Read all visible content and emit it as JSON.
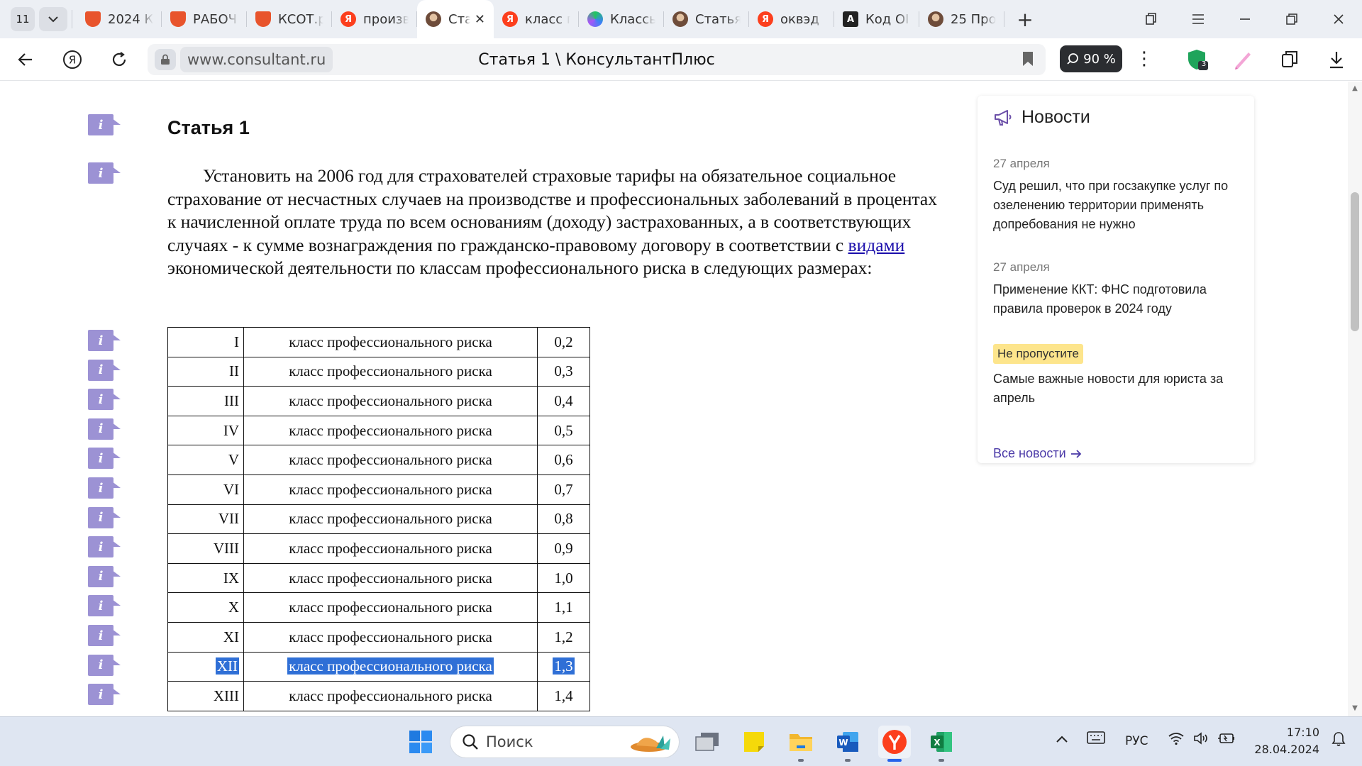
{
  "browser": {
    "tab_count": "11",
    "tabs": [
      {
        "title": "2024 К",
        "favicon": "yellow-shield",
        "color": "#e8542c",
        "letter": ""
      },
      {
        "title": "РАБОЧ",
        "favicon": "yellow-shield",
        "color": "#e8542c",
        "letter": ""
      },
      {
        "title": "КСОТ.р",
        "favicon": "yellow-shield",
        "color": "#e8542c",
        "letter": ""
      },
      {
        "title": "произв",
        "favicon": "yandex",
        "color": "#fc3f1d",
        "letter": "Я"
      },
      {
        "title": "Ста",
        "favicon": "consultant",
        "color": "#7a5c4a",
        "letter": "",
        "active": true
      },
      {
        "title": "класс г",
        "favicon": "yandex",
        "color": "#fc3f1d",
        "letter": "Я"
      },
      {
        "title": "Классь",
        "favicon": "colorful",
        "color": "#22c55e",
        "letter": ""
      },
      {
        "title": "Статья",
        "favicon": "consultant",
        "color": "#7a5c4a",
        "letter": ""
      },
      {
        "title": "оквэд",
        "favicon": "yandex",
        "color": "#fc3f1d",
        "letter": "Я"
      },
      {
        "title": "Код ОІ",
        "favicon": "letter-a",
        "color": "#222222",
        "letter": "A"
      },
      {
        "title": "25 Про",
        "favicon": "consultant",
        "color": "#7a5c4a",
        "letter": ""
      }
    ],
    "url": "www.consultant.ru",
    "page_title": "Статья 1 \\ КонсультантПлюс",
    "zoom": "90 %",
    "ext_badge": "3"
  },
  "article": {
    "title": "Статья 1",
    "para_before": "Установить на 2006 год для страхователей страховые тарифы на обязательное социальное страхование от несчастных случаев на производстве и профессиональных заболеваний в процентах к начисленной оплате труда по всем основаниям (доходу) застрахованных, а в соответствующих случаях - к сумме вознаграждения по гражданско-правовому договору в соответствии с ",
    "link": "видами",
    "para_after": " экономической деятельности по классам профессионального риска в следующих размерах:",
    "rows": [
      {
        "cls": "I",
        "desc": "класс профессионального риска",
        "val": "0,2"
      },
      {
        "cls": "II",
        "desc": "класс профессионального риска",
        "val": "0,3"
      },
      {
        "cls": "III",
        "desc": "класс профессионального риска",
        "val": "0,4"
      },
      {
        "cls": "IV",
        "desc": "класс профессионального риска",
        "val": "0,5"
      },
      {
        "cls": "V",
        "desc": "класс профессионального риска",
        "val": "0,6"
      },
      {
        "cls": "VI",
        "desc": "класс профессионального риска",
        "val": "0,7"
      },
      {
        "cls": "VII",
        "desc": "класс профессионального риска",
        "val": "0,8"
      },
      {
        "cls": "VIII",
        "desc": "класс профессионального риска",
        "val": "0,9"
      },
      {
        "cls": "IX",
        "desc": "класс профессионального риска",
        "val": "1,0"
      },
      {
        "cls": "X",
        "desc": "класс профессионального риска",
        "val": "1,1"
      },
      {
        "cls": "XI",
        "desc": "класс профессионального риска",
        "val": "1,2"
      },
      {
        "cls": "XII",
        "desc": "класс профессионального риска",
        "val": "1,3",
        "selected": true
      },
      {
        "cls": "XIII",
        "desc": "класс профессионального риска",
        "val": "1,4"
      }
    ]
  },
  "news": {
    "heading": "Новости",
    "items": [
      {
        "date": "27 апреля",
        "text": "Суд решил, что при госзакупке услуг по озеленению территории применять допребования не нужно"
      },
      {
        "date": "27 апреля",
        "text": "Применение ККТ: ФНС подготовила правила проверок в 2024 году"
      }
    ],
    "badge": "Не пропустите",
    "featured": "Самые важные новости для юриста за апрель",
    "all_link": "Все новости"
  },
  "taskbar": {
    "search_placeholder": "Поиск",
    "lang": "РУС",
    "time": "17:10",
    "date": "28.04.2024"
  },
  "colors": {
    "info_icon": "#9c92d4",
    "selection": "#2f6fd6",
    "link": "#1a0dab",
    "news_badge": "#fde58c"
  }
}
